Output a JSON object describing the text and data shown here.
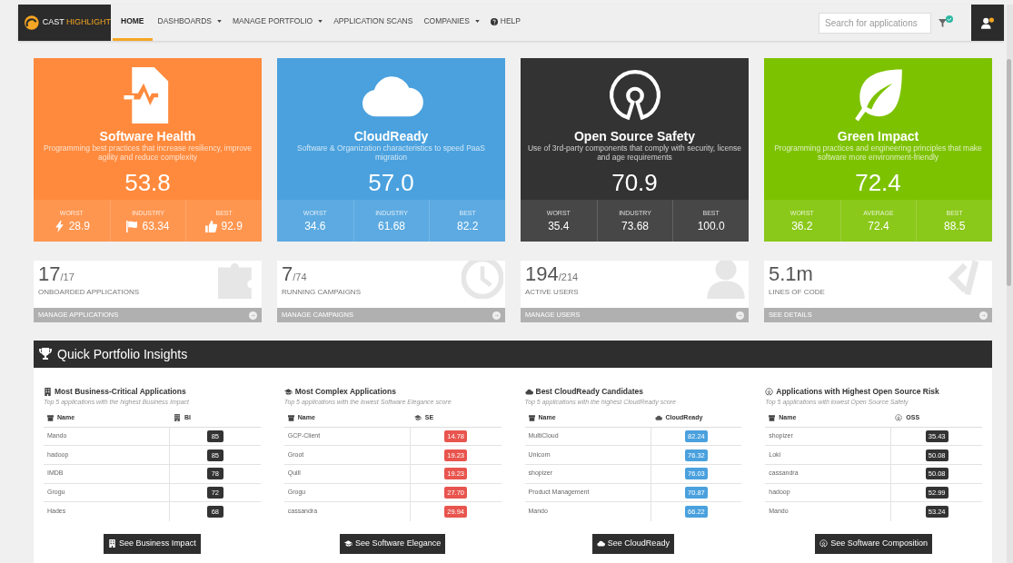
{
  "navbar": {
    "logo": "CAST HIGHLIGHT",
    "items": [
      {
        "label": "HOME",
        "selected": true,
        "dropdown": false,
        "help": false
      },
      {
        "label": "DASHBOARDS",
        "selected": false,
        "dropdown": true,
        "help": false
      },
      {
        "label": "MANAGE PORTFOLIO",
        "selected": false,
        "dropdown": true,
        "help": false
      },
      {
        "label": "APPLICATION SCANS",
        "selected": false,
        "dropdown": false,
        "help": false
      },
      {
        "label": "COMPANIES",
        "selected": false,
        "dropdown": true,
        "help": false
      },
      {
        "label": "HELP",
        "selected": false,
        "dropdown": false,
        "help": true
      }
    ],
    "search": {
      "placeholder": "Search for applications"
    }
  },
  "score_cards": [
    {
      "kind": "health",
      "color": "#ff8a3d",
      "title": "Software Health",
      "description": "Programming best practices that increase resiliency, improve agility and reduce complexity",
      "score": "53.8",
      "metric_icons": true,
      "metrics": [
        {
          "label": "WORST",
          "value": "28.9"
        },
        {
          "label": "INDUSTRY",
          "value": "63.34"
        },
        {
          "label": "BEST",
          "value": "92.9"
        }
      ]
    },
    {
      "kind": "cloud",
      "color": "#4aa1de",
      "title": "CloudReady",
      "description": "Software & Organization characteristics to speed PaaS migration",
      "score": "57.0",
      "metric_icons": false,
      "metrics": [
        {
          "label": "WORST",
          "value": "34.6"
        },
        {
          "label": "INDUSTRY",
          "value": "61.68"
        },
        {
          "label": "BEST",
          "value": "82.2"
        }
      ]
    },
    {
      "kind": "oss",
      "color": "#333333",
      "title": "Open Source Safety",
      "description": "Use of 3rd-party components that comply with security, license and age requirements",
      "score": "70.9",
      "metric_icons": false,
      "metrics": [
        {
          "label": "WORST",
          "value": "35.4"
        },
        {
          "label": "INDUSTRY",
          "value": "73.68"
        },
        {
          "label": "BEST",
          "value": "100.0"
        }
      ]
    },
    {
      "kind": "green",
      "color": "#7dc200",
      "title": "Green Impact",
      "description": "Programming practices and engineering principles that make software more environment-friendly",
      "score": "72.4",
      "metric_icons": false,
      "metrics": [
        {
          "label": "WORST",
          "value": "36.2"
        },
        {
          "label": "AVERAGE",
          "value": "72.4"
        },
        {
          "label": "BEST",
          "value": "88.5"
        }
      ]
    }
  ],
  "stat_cards": [
    {
      "kind": "apps",
      "value": "17",
      "total": "/17",
      "label": "ONBOARDED APPLICATIONS",
      "link": "MANAGE APPLICATIONS"
    },
    {
      "kind": "campaigns",
      "value": "7",
      "total": "/74",
      "label": "RUNNING CAMPAIGNS",
      "link": "MANAGE CAMPAIGNS"
    },
    {
      "kind": "users",
      "value": "194",
      "total": "/214",
      "label": "ACTIVE USERS",
      "link": "MANAGE USERS"
    },
    {
      "kind": "code",
      "value": "5.1m",
      "label": "LINES OF CODE",
      "link": "SEE DETAILS"
    }
  ],
  "insights": {
    "title": "Quick Portfolio Insights",
    "tables": [
      {
        "kind": "impact",
        "color": "#333333",
        "title": "Most Business-Critical Applications",
        "subtitle": "Top 5 applications with the highest Business Impact",
        "columns": [
          "Name",
          "BI"
        ],
        "rows": [
          [
            "Mando",
            "85"
          ],
          [
            "hadoop",
            "85"
          ],
          [
            "IMDB",
            "78"
          ],
          [
            "Grogu",
            "72"
          ],
          [
            "Hades",
            "68"
          ]
        ],
        "button": "See Business Impact"
      },
      {
        "kind": "elegance",
        "color": "#e8554e",
        "title": "Most Complex Applications",
        "subtitle": "Top 5 applications with the lowest Software Elegance score",
        "columns": [
          "Name",
          "SE"
        ],
        "rows": [
          [
            "GCP-Client",
            "14.78"
          ],
          [
            "Groot",
            "19.23"
          ],
          [
            "Quill",
            "19.23"
          ],
          [
            "Grogu",
            "27.70"
          ],
          [
            "cassandra",
            "29.94"
          ]
        ],
        "button": "See Software Elegance"
      },
      {
        "kind": "cloudready",
        "color": "#4aa1de",
        "title": "Best CloudReady Candidates",
        "subtitle": "Top 5 applications with the highest CloudReady score",
        "columns": [
          "Name",
          "CloudReady"
        ],
        "rows": [
          [
            "MultiCloud",
            "82.24"
          ],
          [
            "Unicorn",
            "76.32"
          ],
          [
            "shopizer",
            "76.03"
          ],
          [
            "Product Management",
            "70.87"
          ],
          [
            "Mando",
            "66.22"
          ]
        ],
        "button": "See CloudReady"
      },
      {
        "kind": "oss",
        "color": "#333333",
        "title": "Applications with Highest Open Source Risk",
        "subtitle": "Top 5 applications with lowest Open Source Safety",
        "columns": [
          "Name",
          "OSS"
        ],
        "rows": [
          [
            "shopizer",
            "35.43"
          ],
          [
            "Loki",
            "50.08"
          ],
          [
            "cassandra",
            "50.08"
          ],
          [
            "hadoop",
            "52.99"
          ],
          [
            "Mando",
            "53.24"
          ]
        ],
        "button": "See Software Composition"
      }
    ]
  }
}
